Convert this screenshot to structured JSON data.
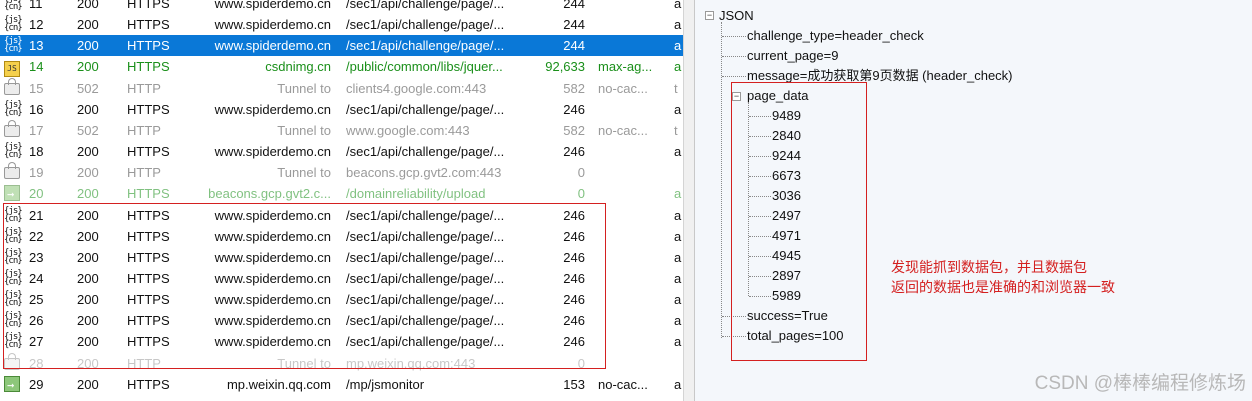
{
  "sessions": [
    {
      "num": "11",
      "result": "200",
      "protocol": "HTTPS",
      "host": "www.spiderdemo.cn",
      "url": "/sec1/api/challenge/page/...",
      "body": "244",
      "caching": "",
      "ctype": "a",
      "icon": "json-icon",
      "style": "normal"
    },
    {
      "num": "12",
      "result": "200",
      "protocol": "HTTPS",
      "host": "www.spiderdemo.cn",
      "url": "/sec1/api/challenge/page/...",
      "body": "244",
      "caching": "",
      "ctype": "a",
      "icon": "json-icon",
      "style": "normal"
    },
    {
      "num": "13",
      "result": "200",
      "protocol": "HTTPS",
      "host": "www.spiderdemo.cn",
      "url": "/sec1/api/challenge/page/...",
      "body": "244",
      "caching": "",
      "ctype": "a",
      "icon": "json-icon",
      "style": "sel"
    },
    {
      "num": "14",
      "result": "200",
      "protocol": "HTTPS",
      "host": "csdnimg.cn",
      "url": "/public/common/libs/jquer...",
      "body": "92,633",
      "caching": "max-ag...",
      "ctype": "a",
      "icon": "js-icon",
      "style": "green"
    },
    {
      "num": "15",
      "result": "502",
      "protocol": "HTTP",
      "host": "Tunnel to",
      "url": "clients4.google.com:443",
      "body": "582",
      "caching": "no-cac...",
      "ctype": "t",
      "icon": "lock-icon",
      "style": "gray"
    },
    {
      "num": "16",
      "result": "200",
      "protocol": "HTTPS",
      "host": "www.spiderdemo.cn",
      "url": "/sec1/api/challenge/page/...",
      "body": "246",
      "caching": "",
      "ctype": "a",
      "icon": "json-icon",
      "style": "normal"
    },
    {
      "num": "17",
      "result": "502",
      "protocol": "HTTP",
      "host": "Tunnel to",
      "url": "www.google.com:443",
      "body": "582",
      "caching": "no-cac...",
      "ctype": "t",
      "icon": "lock-icon",
      "style": "gray"
    },
    {
      "num": "18",
      "result": "200",
      "protocol": "HTTPS",
      "host": "www.spiderdemo.cn",
      "url": "/sec1/api/challenge/page/...",
      "body": "246",
      "caching": "",
      "ctype": "a",
      "icon": "json-icon",
      "style": "normal"
    },
    {
      "num": "19",
      "result": "200",
      "protocol": "HTTP",
      "host": "Tunnel to",
      "url": "beacons.gcp.gvt2.com:443",
      "body": "0",
      "caching": "",
      "ctype": "",
      "icon": "lock-icon",
      "style": "gray"
    },
    {
      "num": "20",
      "result": "200",
      "protocol": "HTTPS",
      "host": "beacons.gcp.gvt2.c...",
      "url": "/domainreliability/upload",
      "body": "0",
      "caching": "",
      "ctype": "a",
      "icon": "arrow-icon",
      "style": "green cut"
    },
    {
      "num": "21",
      "result": "200",
      "protocol": "HTTPS",
      "host": "www.spiderdemo.cn",
      "url": "/sec1/api/challenge/page/...",
      "body": "246",
      "caching": "",
      "ctype": "a",
      "icon": "json-icon",
      "style": "normal"
    },
    {
      "num": "22",
      "result": "200",
      "protocol": "HTTPS",
      "host": "www.spiderdemo.cn",
      "url": "/sec1/api/challenge/page/...",
      "body": "246",
      "caching": "",
      "ctype": "a",
      "icon": "json-icon",
      "style": "normal"
    },
    {
      "num": "23",
      "result": "200",
      "protocol": "HTTPS",
      "host": "www.spiderdemo.cn",
      "url": "/sec1/api/challenge/page/...",
      "body": "246",
      "caching": "",
      "ctype": "a",
      "icon": "json-icon",
      "style": "normal"
    },
    {
      "num": "24",
      "result": "200",
      "protocol": "HTTPS",
      "host": "www.spiderdemo.cn",
      "url": "/sec1/api/challenge/page/...",
      "body": "246",
      "caching": "",
      "ctype": "a",
      "icon": "json-icon",
      "style": "normal"
    },
    {
      "num": "25",
      "result": "200",
      "protocol": "HTTPS",
      "host": "www.spiderdemo.cn",
      "url": "/sec1/api/challenge/page/...",
      "body": "246",
      "caching": "",
      "ctype": "a",
      "icon": "json-icon",
      "style": "normal"
    },
    {
      "num": "26",
      "result": "200",
      "protocol": "HTTPS",
      "host": "www.spiderdemo.cn",
      "url": "/sec1/api/challenge/page/...",
      "body": "246",
      "caching": "",
      "ctype": "a",
      "icon": "json-icon",
      "style": "normal"
    },
    {
      "num": "27",
      "result": "200",
      "protocol": "HTTPS",
      "host": "www.spiderdemo.cn",
      "url": "/sec1/api/challenge/page/...",
      "body": "246",
      "caching": "",
      "ctype": "a",
      "icon": "json-icon",
      "style": "normal"
    },
    {
      "num": "28",
      "result": "200",
      "protocol": "HTTP",
      "host": "Tunnel to",
      "url": "mp.weixin.qq.com:443",
      "body": "0",
      "caching": "",
      "ctype": "",
      "icon": "lock-icon",
      "style": "gray cut"
    },
    {
      "num": "29",
      "result": "200",
      "protocol": "HTTPS",
      "host": "mp.weixin.qq.com",
      "url": "/mp/jsmonitor",
      "body": "153",
      "caching": "no-cac...",
      "ctype": "a",
      "icon": "arrow-icon",
      "style": "normal"
    }
  ],
  "json_tree": {
    "root": "JSON",
    "challenge_type": "challenge_type=header_check",
    "current_page": "current_page=9",
    "message": "message=成功获取第9页数据 (header_check)",
    "page_data_label": "page_data",
    "page_data": [
      "9489",
      "2840",
      "9244",
      "6673",
      "3036",
      "2497",
      "4971",
      "4945",
      "2897",
      "5989"
    ],
    "success": "success=True",
    "total_pages": "total_pages=100"
  },
  "annotation": {
    "line1": "发现能抓到数据包，并且数据包",
    "line2": "返回的数据也是准确的和浏览器一致",
    "color": "#d42020"
  },
  "watermark": "CSDN @棒棒编程修炼场",
  "colors": {
    "selected_row": "#0a78d7",
    "green_row": "#1a8f1a",
    "gray_row": "#9a9a9a",
    "annotation_box": "#d42020"
  }
}
